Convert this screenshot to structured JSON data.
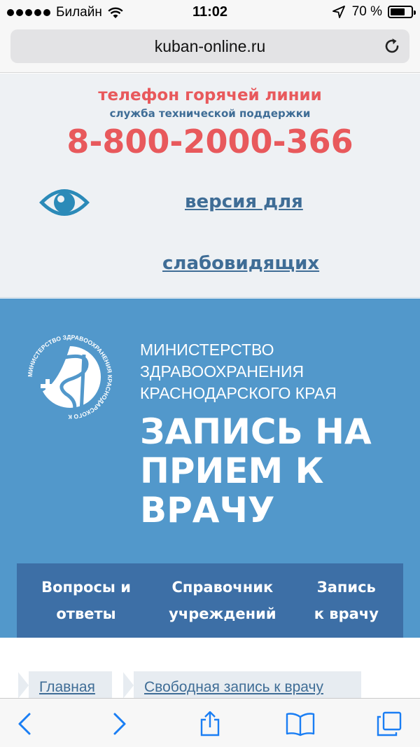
{
  "status_bar": {
    "carrier": "Билайн",
    "time": "11:02",
    "battery": "70 %",
    "battery_level": 0.7,
    "icons": [
      "signal-dots-icon",
      "wifi-icon",
      "location-arrow-icon",
      "battery-icon"
    ]
  },
  "browser": {
    "url": "kuban-online.ru",
    "reload_icon": "reload-icon"
  },
  "hotline": {
    "title": "телефон горячей линии",
    "subtitle": "служба технической поддержки",
    "phone": "8-800-2000-366",
    "low_vision_line1": "версия для",
    "low_vision_line2": "слабовидящих",
    "icon": "eye-icon"
  },
  "hero": {
    "ministry_line1": "МИНИСТЕРСТВО",
    "ministry_line2": "ЗДРАВООХРАНЕНИЯ",
    "ministry_line3": "КРАСНОДАРСКОГО КРАЯ",
    "title_line1": "ЗАПИСЬ НА",
    "title_line2": "ПРИЕМ К",
    "title_line3": "ВРАЧУ",
    "logo_text": "МИНИСТЕРСТВО ЗДРАВООХРАНЕНИЯ КРАСНОДАРСКОГО КРАЯ"
  },
  "nav": {
    "items": [
      {
        "line1": "Вопросы и",
        "line2": "ответы"
      },
      {
        "line1": "Справочник",
        "line2": "учреждений"
      },
      {
        "line1": "Запись",
        "line2": "к врачу"
      }
    ]
  },
  "breadcrumb": {
    "items": [
      "Главная",
      "Свободная запись к врачу"
    ]
  },
  "toolbar": {
    "icons": [
      "back-icon",
      "forward-icon",
      "share-icon",
      "bookmarks-icon",
      "tabs-icon"
    ]
  },
  "colors": {
    "accent_red": "#e8595c",
    "accent_blue": "#3f6d96",
    "hero_blue": "#5298cb",
    "nav_blue": "#3d6fa6",
    "ios_blue": "#1a7ef4"
  }
}
